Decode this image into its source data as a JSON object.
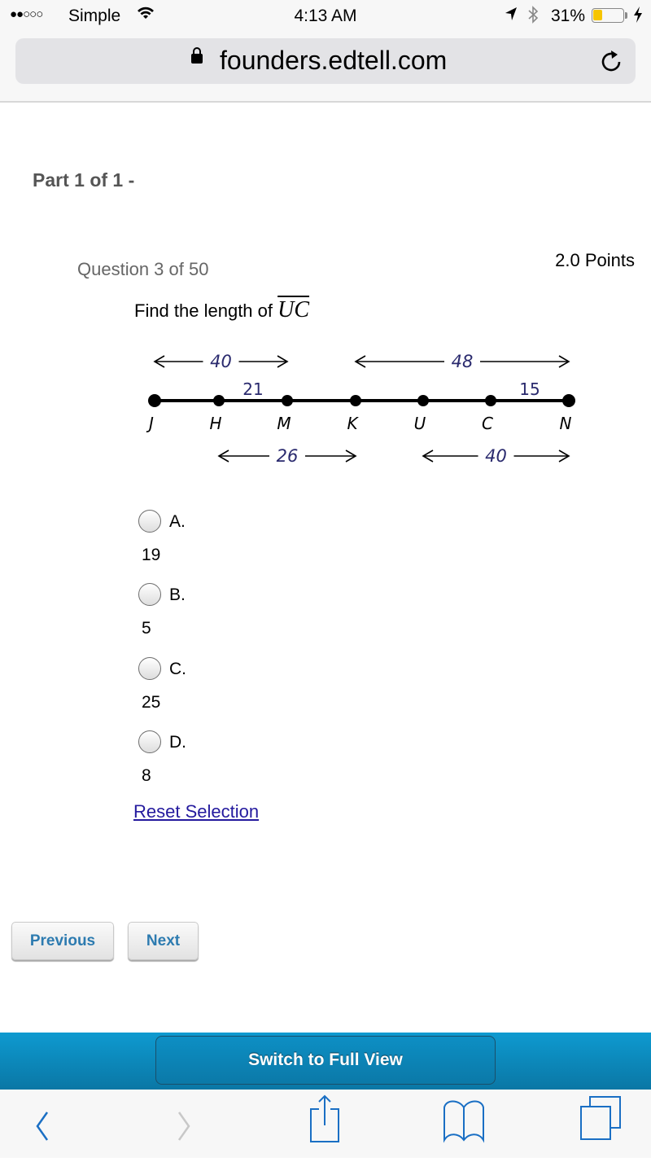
{
  "status_bar": {
    "signal": "●●○○○",
    "carrier": "Simple",
    "time": "4:13 AM",
    "battery_percent": "31%",
    "battery_level": 0.31
  },
  "browser": {
    "url": "founders.edtell.com",
    "icons": [
      "lock-icon",
      "reload-icon"
    ]
  },
  "page": {
    "part_label": "Part 1 of 1 -",
    "question_number": "Question 3 of 50",
    "points": "2.0 Points",
    "prompt_text": "Find the length of ",
    "prompt_segment": "UC"
  },
  "diagram": {
    "points": [
      "J",
      "H",
      "M",
      "K",
      "U",
      "C",
      "N"
    ],
    "segment_labels": [
      {
        "from": "H",
        "to": "M",
        "value": "21"
      },
      {
        "from": "C",
        "to": "N",
        "value": "15"
      }
    ],
    "spans": [
      {
        "from": "J",
        "to": "M",
        "value": "40",
        "position": "above"
      },
      {
        "from": "K",
        "to": "N",
        "value": "48",
        "position": "above"
      },
      {
        "from": "H",
        "to": "K",
        "value": "26",
        "position": "below"
      },
      {
        "from": "U",
        "to": "N",
        "value": "40",
        "position": "below"
      }
    ],
    "label_color": "#2a2a6e"
  },
  "choices": [
    {
      "letter": "A.",
      "answer": "19",
      "selected": false
    },
    {
      "letter": "B.",
      "answer": "5",
      "selected": false
    },
    {
      "letter": "C.",
      "answer": "25",
      "selected": false
    },
    {
      "letter": "D.",
      "answer": "8",
      "selected": false
    }
  ],
  "reset_label": "Reset Selection",
  "nav": {
    "previous": "Previous",
    "next": "Next"
  },
  "banner": {
    "full_view": "Switch to Full View"
  },
  "toolbar": {
    "items": [
      "back-icon",
      "forward-icon",
      "share-icon",
      "bookmarks-icon",
      "tabs-icon"
    ]
  },
  "colors": {
    "link": "#241a9e",
    "nav_button_text": "#2d7bb0",
    "banner": "#0a86b8",
    "toolbar_icon": "#1a6fc4"
  }
}
